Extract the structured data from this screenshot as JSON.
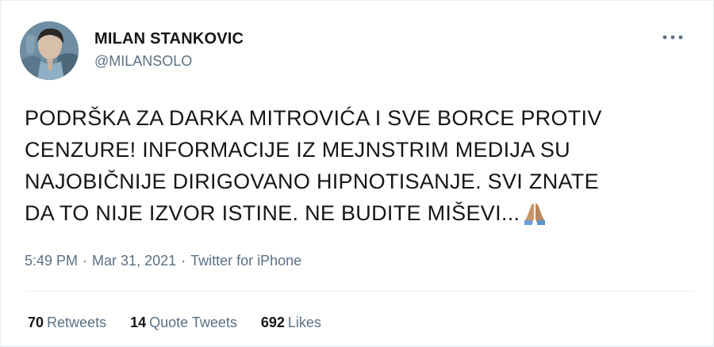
{
  "user": {
    "display_name": "MILAN STANKOVIC",
    "handle": "@MILANSOLO",
    "avatar_icon": "avatar-photo"
  },
  "more_icon": "more-horizontal-icon",
  "tweet": {
    "lines": [
      "PODRŠKA ZA DARKA MITROVIĆA I SVE BORCE PROTIV",
      "CENZURE! INFORMACIJE IZ MEJNSTRIM MEDIJA SU",
      "NAJOBIČNIJE DIRIGOVANO HIPNOTISANJE. SVI ZNATE",
      "DA TO NIJE IZVOR ISTINE. NE BUDITE MIŠEVI..."
    ],
    "emoji": "folded-hands-icon"
  },
  "meta": {
    "time": "5:49 PM",
    "separator": "·",
    "date": "Mar 31, 2021",
    "source": "Twitter for iPhone"
  },
  "stats": {
    "retweets_count": "70",
    "retweets_label": "Retweets",
    "quotes_count": "14",
    "quotes_label": "Quote Tweets",
    "likes_count": "692",
    "likes_label": "Likes"
  },
  "colors": {
    "text_primary": "#14171a",
    "text_secondary": "#5b7083",
    "border": "#e6ecf0"
  }
}
